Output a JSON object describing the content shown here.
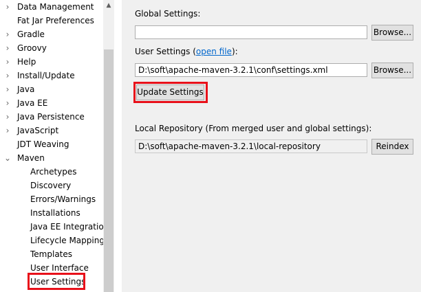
{
  "tree": {
    "items": [
      {
        "label": "Data Management",
        "expandable": true
      },
      {
        "label": "Fat Jar Preferences",
        "expandable": false
      },
      {
        "label": "Gradle",
        "expandable": true
      },
      {
        "label": "Groovy",
        "expandable": true
      },
      {
        "label": "Help",
        "expandable": true
      },
      {
        "label": "Install/Update",
        "expandable": true
      },
      {
        "label": "Java",
        "expandable": true
      },
      {
        "label": "Java EE",
        "expandable": true
      },
      {
        "label": "Java Persistence",
        "expandable": true
      },
      {
        "label": "JavaScript",
        "expandable": true
      },
      {
        "label": "JDT Weaving",
        "expandable": false
      },
      {
        "label": "Maven",
        "expandable": true,
        "expanded": true
      }
    ],
    "maven_children": [
      "Archetypes",
      "Discovery",
      "Errors/Warnings",
      "Installations",
      "Java EE Integration",
      "Lifecycle Mapping",
      "Templates",
      "User Interface",
      "User Settings"
    ],
    "selected": "User Settings"
  },
  "settings": {
    "global_label": "Global Settings:",
    "global_value": "",
    "browse_label": "Browse...",
    "user_label_prefix": "User Settings (",
    "user_label_link": "open file",
    "user_label_suffix": "):",
    "user_value": "D:\\soft\\apache-maven-3.2.1\\conf\\settings.xml",
    "update_label": "Update Settings",
    "local_repo_label": "Local Repository (From merged user and global settings):",
    "local_repo_value": "D:\\soft\\apache-maven-3.2.1\\local-repository",
    "reindex_label": "Reindex"
  },
  "colors": {
    "highlight": "#e8101a",
    "link": "#0066cc",
    "panel_bg": "#f0f0f0"
  }
}
